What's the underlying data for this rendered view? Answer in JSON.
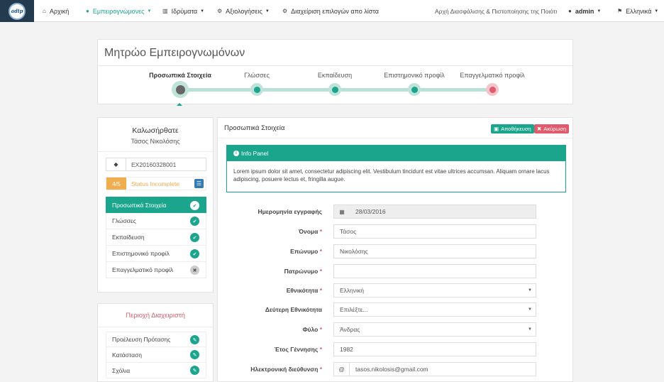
{
  "navbar": {
    "logo_text": "adip",
    "items": [
      {
        "label": "Αρχική",
        "icon": "home-icon",
        "glyph": "⌂",
        "dropdown": false,
        "active": false
      },
      {
        "label": "Εμπειρογνώμονες",
        "icon": "user-icon",
        "glyph": "●",
        "dropdown": true,
        "active": true
      },
      {
        "label": "Ιδρύματα",
        "icon": "institution-icon",
        "glyph": "▥",
        "dropdown": true,
        "active": false
      },
      {
        "label": "Αξιολογήσεις",
        "icon": "cogs-icon",
        "glyph": "⚙",
        "dropdown": true,
        "active": false
      },
      {
        "label": "Διαχείριση επιλογών απο λίστα",
        "icon": "gear-icon",
        "glyph": "⚙",
        "dropdown": false,
        "active": false
      }
    ],
    "org_title": "Αρχή Διασφάλισης & Πιστοποίησης της Ποιότητας",
    "user": "admin",
    "language": "Ελληνικά"
  },
  "page": {
    "title": "Μητρώο Εμπειρογνωμόνων"
  },
  "wizard": {
    "steps": [
      {
        "label": "Προσωπικά Στοιχεία",
        "state": "current"
      },
      {
        "label": "Γλώσσες",
        "state": "complete"
      },
      {
        "label": "Εκπαίδευση",
        "state": "complete"
      },
      {
        "label": "Επιστημονικό προφίλ",
        "state": "complete"
      },
      {
        "label": "Επαγγελματικό προφίλ",
        "state": "incomplete"
      }
    ]
  },
  "sidebar": {
    "welcome": "Καλωσήρθατε",
    "user_name": "Τάσος Νικολόσης",
    "code": "EX20160328001",
    "progress_count": "4/5",
    "status": "Status Incomplete",
    "items": [
      {
        "label": "Προσωπικά Στοιχεία",
        "done": true,
        "active": true
      },
      {
        "label": "Γλώσσες",
        "done": true,
        "active": false
      },
      {
        "label": "Εκπαίδευση",
        "done": true,
        "active": false
      },
      {
        "label": "Επιστημονικό προφίλ",
        "done": true,
        "active": false
      },
      {
        "label": "Επαγγελματικό προφίλ",
        "done": false,
        "active": false
      }
    ]
  },
  "admin_area": {
    "title": "Περιοχή Διαχειριστή",
    "items": [
      {
        "label": "Προέλευση Πρότασης"
      },
      {
        "label": "Κατάσταση"
      },
      {
        "label": "Σχόλια"
      }
    ]
  },
  "main": {
    "title": "Προσωπικά Στοιχεία",
    "save_label": "Αποθήκευση",
    "cancel_label": "Ακύρωση",
    "info_title": "Info Panel",
    "info_text": "Lorem ipsum dolor sit amet, consectetur adipiscing elit. Vestibulum tincidunt est vitae ultrices accumsan. Aliquam ornare lacus adipiscing, posuere lectus et, fringilla augue.",
    "fields": [
      {
        "name": "registration-date-field",
        "label": "Ημερομηνία εγγραφής",
        "required": false,
        "value": "28/03/2016",
        "type": "date",
        "disabled": true
      },
      {
        "name": "first-name-field",
        "label": "Όνομα",
        "required": true,
        "value": "Τάσος",
        "type": "text",
        "disabled": false
      },
      {
        "name": "last-name-field",
        "label": "Επώνυμο",
        "required": true,
        "value": "Νικολόσης",
        "type": "text",
        "disabled": false
      },
      {
        "name": "father-name-field",
        "label": "Πατρώνυμο",
        "required": true,
        "value": "",
        "type": "text",
        "disabled": false
      },
      {
        "name": "nationality-select",
        "label": "Εθνικότητα",
        "required": true,
        "value": "Ελληνική",
        "type": "select",
        "disabled": false
      },
      {
        "name": "second-nationality-select",
        "label": "Δεύτερη Εθνικότητα",
        "required": false,
        "value": "Επιλέξτε...",
        "type": "select",
        "disabled": false
      },
      {
        "name": "gender-select",
        "label": "Φύλο",
        "required": true,
        "value": "Άνδρας",
        "type": "select",
        "disabled": false
      },
      {
        "name": "birth-year-field",
        "label": "Έτος Γέννησης",
        "required": true,
        "value": "1982",
        "type": "text",
        "disabled": false
      },
      {
        "name": "email-field",
        "label": "Ηλεκτρονική διεύθυνση",
        "required": true,
        "value": "tasos.nikolosis@gmail.com",
        "type": "email",
        "disabled": false
      }
    ]
  },
  "colors": {
    "accent": "#1aa58c",
    "danger": "#e05b6b",
    "warning": "#f0ad4e",
    "navbar_logo_bg": "#243a4e"
  }
}
